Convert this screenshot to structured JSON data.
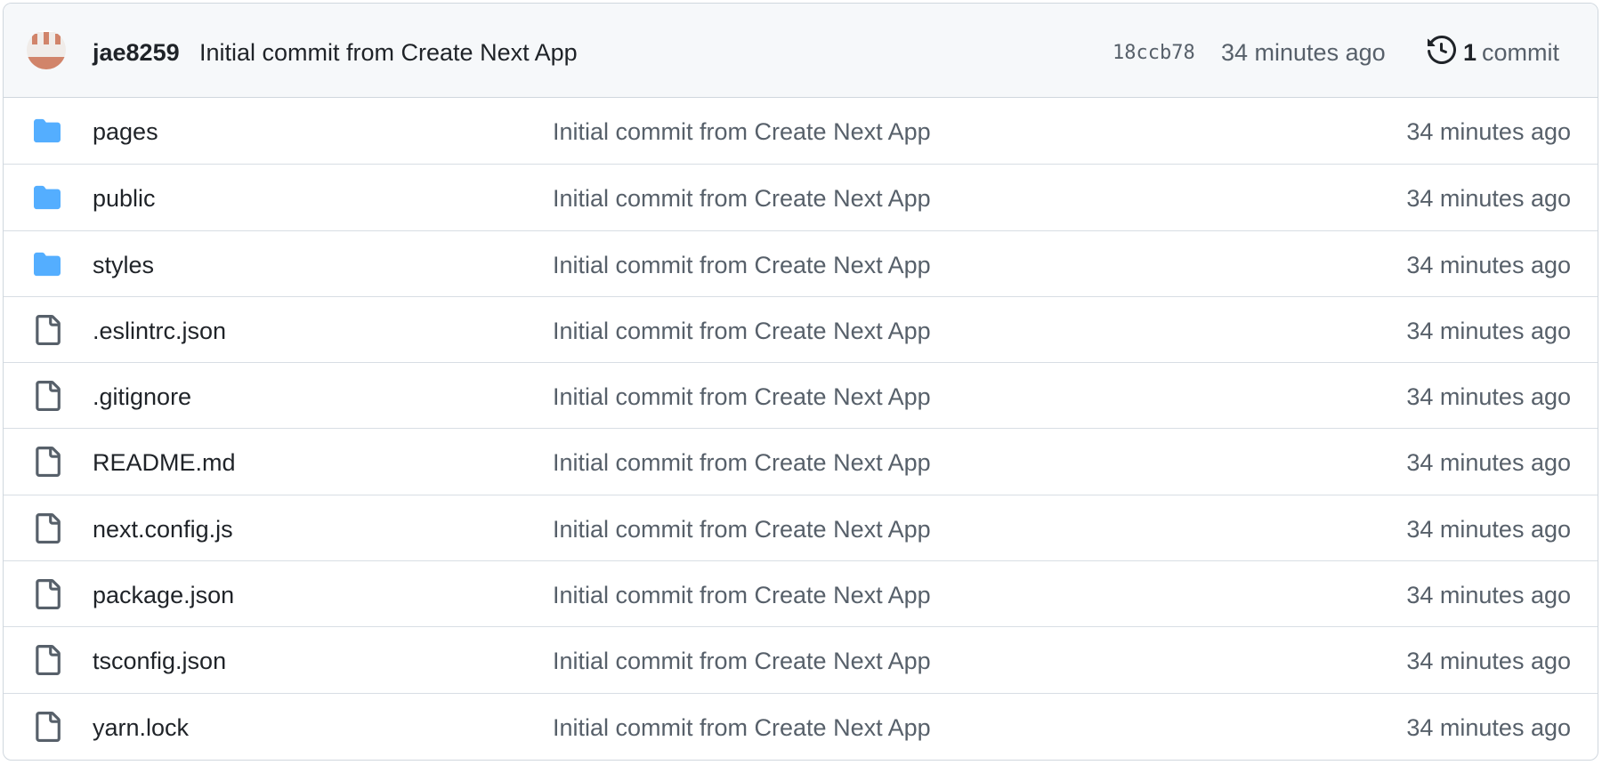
{
  "latest_commit": {
    "author": "jae8259",
    "message": "Initial commit from Create Next App",
    "sha": "18ccb78",
    "time": "34 minutes ago",
    "history_count": "1",
    "history_label": "commit"
  },
  "files": [
    {
      "name": "pages",
      "type": "folder",
      "icon": "folder-icon",
      "message": "Initial commit from Create Next App",
      "time": "34 minutes ago"
    },
    {
      "name": "public",
      "type": "folder",
      "icon": "folder-icon",
      "message": "Initial commit from Create Next App",
      "time": "34 minutes ago"
    },
    {
      "name": "styles",
      "type": "folder",
      "icon": "folder-icon",
      "message": "Initial commit from Create Next App",
      "time": "34 minutes ago"
    },
    {
      "name": ".eslintrc.json",
      "type": "file",
      "icon": "file-icon",
      "message": "Initial commit from Create Next App",
      "time": "34 minutes ago"
    },
    {
      "name": ".gitignore",
      "type": "file",
      "icon": "file-icon",
      "message": "Initial commit from Create Next App",
      "time": "34 minutes ago"
    },
    {
      "name": "README.md",
      "type": "file",
      "icon": "file-icon",
      "message": "Initial commit from Create Next App",
      "time": "34 minutes ago"
    },
    {
      "name": "next.config.js",
      "type": "file",
      "icon": "file-icon",
      "message": "Initial commit from Create Next App",
      "time": "34 minutes ago"
    },
    {
      "name": "package.json",
      "type": "file",
      "icon": "file-icon",
      "message": "Initial commit from Create Next App",
      "time": "34 minutes ago"
    },
    {
      "name": "tsconfig.json",
      "type": "file",
      "icon": "file-icon",
      "message": "Initial commit from Create Next App",
      "time": "34 minutes ago"
    },
    {
      "name": "yarn.lock",
      "type": "file",
      "icon": "file-icon",
      "message": "Initial commit from Create Next App",
      "time": "34 minutes ago"
    }
  ],
  "colors": {
    "folder": "#54aeff",
    "file_icon": "#57606a",
    "header_bg": "#f6f8fa",
    "border": "#d0d7de",
    "muted_text": "#57606a",
    "avatar_accent": "#d1846a"
  }
}
